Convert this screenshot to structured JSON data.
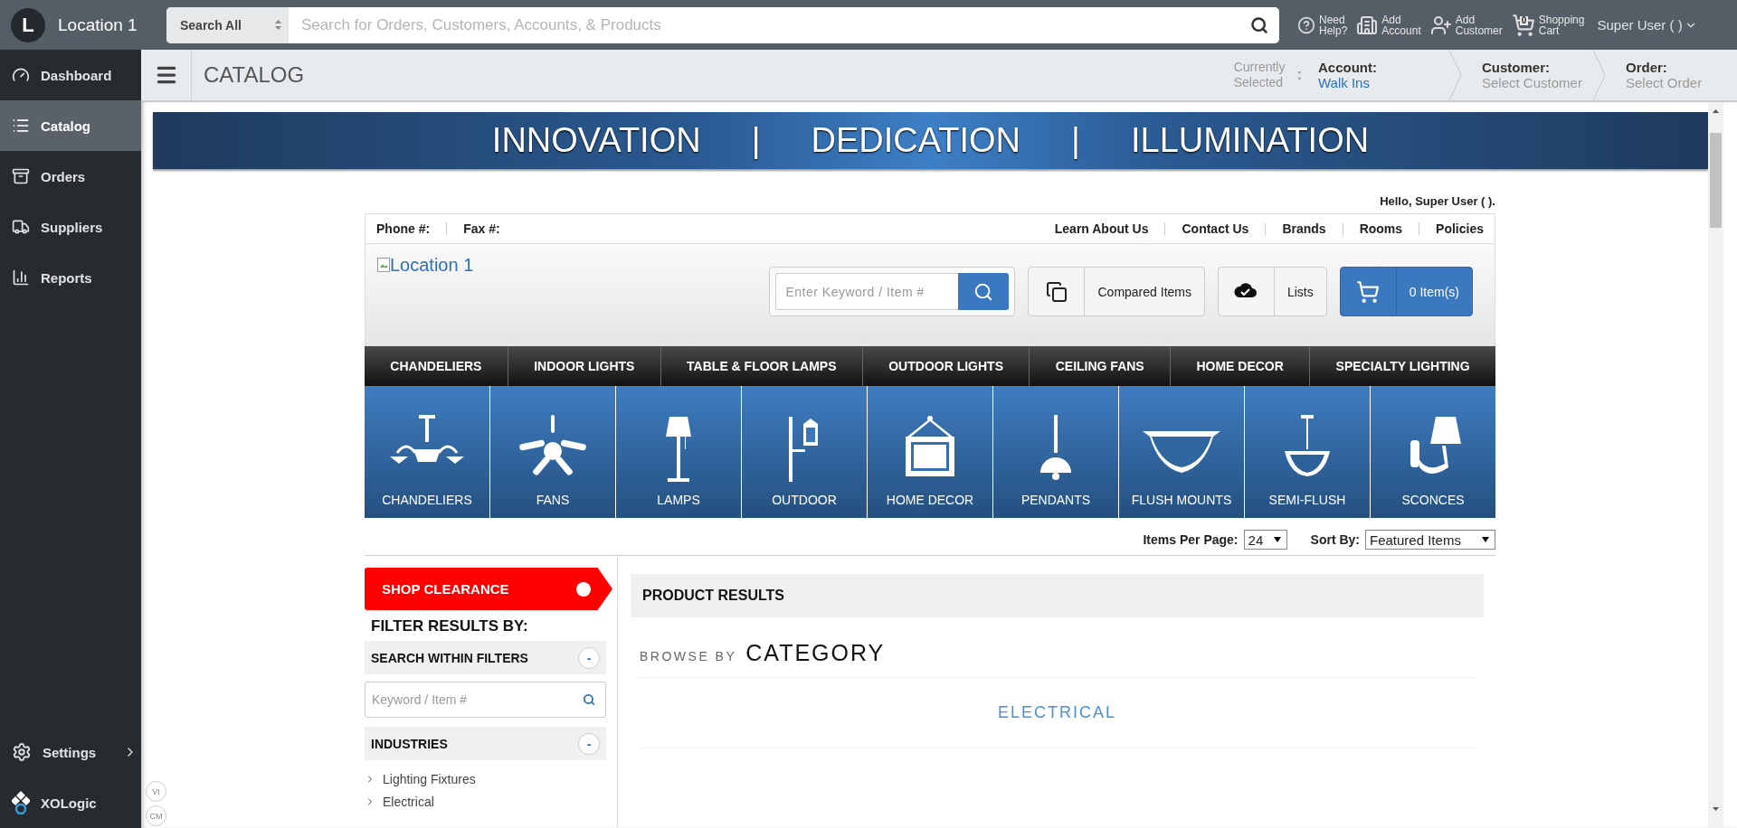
{
  "topbar": {
    "initial": "L",
    "location": "Location 1",
    "search_scope": "Search All",
    "search_placeholder": "Search for Orders, Customers, Accounts, & Products",
    "actions": [
      {
        "kind": "help",
        "line1": "Need",
        "line2": "Help?"
      },
      {
        "kind": "account",
        "line1": "Add",
        "line2": "Account"
      },
      {
        "kind": "customer",
        "line1": "Add",
        "line2": "Customer"
      },
      {
        "kind": "cart",
        "line1": "Shopping",
        "line2": "Cart",
        "count": "0"
      }
    ],
    "user": "Super User ( )"
  },
  "sidebar": {
    "items": [
      {
        "kind": "dashboard",
        "label": "Dashboard",
        "selected": false
      },
      {
        "kind": "catalog",
        "label": "Catalog",
        "selected": true
      },
      {
        "kind": "orders",
        "label": "Orders",
        "selected": false
      },
      {
        "kind": "suppliers",
        "label": "Suppliers",
        "selected": false
      },
      {
        "kind": "reports",
        "label": "Reports",
        "selected": false
      }
    ],
    "settings": "Settings",
    "brand": "XOLogic"
  },
  "page_header": {
    "title": "CATALOG",
    "currently": "Currently Selected",
    "colon": ":",
    "crumbs": [
      {
        "label": "Account:",
        "value": "Walk Ins",
        "set": true
      },
      {
        "label": "Customer:",
        "value": "Select Customer",
        "set": false
      },
      {
        "label": "Order:",
        "value": "Select Order",
        "set": false
      }
    ]
  },
  "banner": {
    "words": [
      "INNOVATION",
      "DEDICATION",
      "ILLUMINATION"
    ],
    "separator": "|"
  },
  "store": {
    "greeting": "Hello, Super User ( ).",
    "contact": [
      "Phone #:",
      "Fax #:"
    ],
    "links": [
      "Learn About Us",
      "Contact Us",
      "Brands",
      "Rooms",
      "Policies"
    ],
    "logo_alt": "Location 1",
    "search_placeholder": "Enter Keyword / Item #",
    "compared": "Compared Items",
    "lists": "Lists",
    "cart": "0 Item(s)",
    "nav": [
      "CHANDELIERS",
      "INDOOR LIGHTS",
      "TABLE & FLOOR LAMPS",
      "OUTDOOR LIGHTS",
      "CEILING FANS",
      "HOME DECOR",
      "SPECIALTY LIGHTING"
    ],
    "categories": [
      {
        "kind": "chandelier",
        "label": "CHANDELIERS"
      },
      {
        "kind": "fan",
        "label": "FANS"
      },
      {
        "kind": "lamp",
        "label": "LAMPS"
      },
      {
        "kind": "outdoor",
        "label": "OUTDOOR"
      },
      {
        "kind": "frame",
        "label": "HOME DECOR"
      },
      {
        "kind": "pendant",
        "label": "PENDANTS"
      },
      {
        "kind": "flush",
        "label": "FLUSH MOUNTS"
      },
      {
        "kind": "semiflush",
        "label": "SEMI-FLUSH"
      },
      {
        "kind": "sconce",
        "label": "SCONCES"
      }
    ],
    "items_per_page": {
      "label": "Items Per Page:",
      "value": "24"
    },
    "sort": {
      "label": "Sort By:",
      "value": "Featured Items"
    },
    "clearance": "SHOP CLEARANCE",
    "filter_title": "FILTER RESULTS BY:",
    "filters": [
      {
        "title": "SEARCH WITHIN FILTERS",
        "toggle": "-",
        "placeholder": "Keyword / Item #"
      },
      {
        "title": "INDUSTRIES",
        "toggle": "-",
        "items": [
          "Lighting Fixtures",
          "Electrical"
        ]
      }
    ],
    "results_title": "PRODUCT RESULTS",
    "browse_prefix": "BROWSE BY",
    "browse_title": "CATEGORY",
    "browse_items": [
      "ELECTRICAL"
    ]
  },
  "side_badges": [
    "VI",
    "CM"
  ]
}
